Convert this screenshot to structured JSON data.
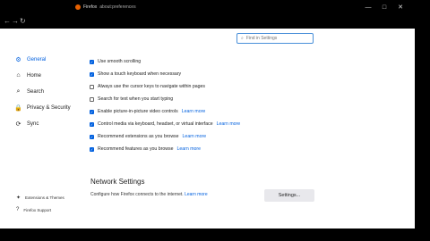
{
  "tab": {
    "title": "Firefox",
    "url": "about:preferences"
  },
  "window": {
    "min": "—",
    "max": "□",
    "close": "✕"
  },
  "nav": {
    "back": "←",
    "forward": "→",
    "reload": "↻"
  },
  "search": {
    "placeholder": "Find in Settings"
  },
  "sidebar": {
    "items": [
      {
        "label": "General",
        "icon": "gear-icon",
        "glyph": "⚙"
      },
      {
        "label": "Home",
        "icon": "home-icon",
        "glyph": "⌂"
      },
      {
        "label": "Search",
        "icon": "search-icon",
        "glyph": "⌕"
      },
      {
        "label": "Privacy & Security",
        "icon": "lock-icon",
        "glyph": "🔒"
      },
      {
        "label": "Sync",
        "icon": "sync-icon",
        "glyph": "⟳"
      }
    ],
    "bottom": [
      {
        "label": "Extensions & Themes",
        "icon": "puzzle-icon",
        "glyph": "✦"
      },
      {
        "label": "Firefox Support",
        "icon": "help-icon",
        "glyph": "?"
      }
    ]
  },
  "options": [
    {
      "label": "Use smooth scrolling",
      "checked": true
    },
    {
      "label": "Show a touch keyboard when necessary",
      "checked": true
    },
    {
      "label": "Always use the cursor keys to navigate within pages",
      "checked": false
    },
    {
      "label": "Search for text when you start typing",
      "checked": false
    },
    {
      "label": "Enable picture-in-picture video controls",
      "checked": true,
      "link": "Learn more"
    },
    {
      "label": "Control media via keyboard, headset, or virtual interface",
      "checked": true,
      "link": "Learn more"
    },
    {
      "label": "Recommend extensions as you browse",
      "checked": true,
      "link": "Learn more"
    },
    {
      "label": "Recommend features as you browse",
      "checked": true,
      "link": "Learn more"
    }
  ],
  "network": {
    "title": "Network Settings",
    "desc": "Configure how Firefox connects to the internet.",
    "link": "Learn more",
    "button": "Settings..."
  },
  "colors": {
    "accent": "#0060df"
  }
}
